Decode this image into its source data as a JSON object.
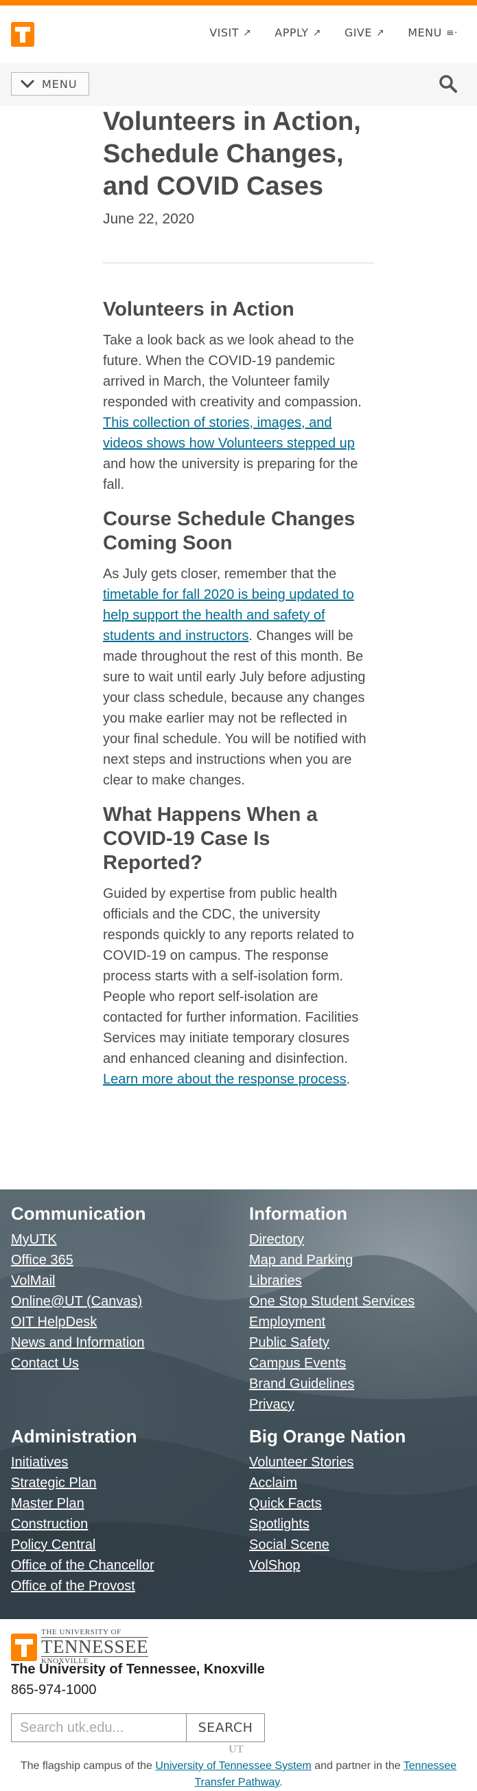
{
  "header": {
    "nav": [
      {
        "label": "VISIT",
        "suffix": "↗"
      },
      {
        "label": "APPLY",
        "suffix": "↗"
      },
      {
        "label": "GIVE",
        "suffix": "↗"
      },
      {
        "label": "MENU",
        "suffix": "≡·"
      }
    ],
    "sub_menu_label": "MENU",
    "colors": {
      "accent": "#ff8200",
      "link": "#006c93",
      "text": "#4b4b4b"
    }
  },
  "article": {
    "title": "Volunteers in Action, Schedule Changes, and COVID Cases",
    "date": "June 22, 2020",
    "s1": {
      "heading": "Volunteers in Action",
      "text_before": "Take a look back as we look ahead to the future. When the COVID-19 pandemic arrived in March, the Volunteer family responded with creativity and compassion. ",
      "link": "This collection of stories, images, and videos shows how Volunteers stepped up",
      "text_after": " and how the university is preparing for the fall."
    },
    "s2": {
      "heading": "Course Schedule Changes Coming Soon",
      "text_before": "As July gets closer, remember that the ",
      "link": "timetable for fall 2020 is being updated to help support the health and safety of students and instructors",
      "text_after": ". Changes will be made throughout the rest of this month. Be sure to wait until early July before adjusting your class schedule, because any changes you make earlier may not be reflected in your final schedule. You will be notified with next steps and instructions when you are clear to make changes."
    },
    "s3": {
      "heading": "What Happens When a COVID-19 Case Is Reported?",
      "text_before": "Guided by expertise from public health officials and the CDC, the university responds quickly to any reports related to COVID-19 on campus. The response process starts with a self-isolation form. People who report self-isolation are contacted for further information. Facilities Services may initiate temporary closures and enhanced cleaning and disinfection. ",
      "link": "Learn more about the response process",
      "text_after": "."
    }
  },
  "footer": {
    "communication": {
      "heading": "Communication",
      "links": [
        "MyUTK",
        "Office 365",
        "VolMail",
        "Online@UT (Canvas)",
        "OIT HelpDesk",
        "News and Information",
        "Contact Us"
      ]
    },
    "information": {
      "heading": "Information",
      "links": [
        "Directory",
        "Map and Parking",
        "Libraries",
        "One Stop Student Services",
        "Employment",
        "Public Safety",
        "Campus Events",
        "Brand Guidelines",
        "Privacy"
      ]
    },
    "administration": {
      "heading": "Administration",
      "links": [
        "Initiatives",
        "Strategic Plan",
        "Master Plan",
        "Construction",
        "Policy Central",
        "Office of the Chancellor",
        "Office of the Provost"
      ]
    },
    "big_orange": {
      "heading": "Big Orange Nation",
      "links": [
        "Volunteer Stories",
        "Acclaim",
        "Quick Facts",
        "Spotlights",
        "Social Scene",
        "VolShop"
      ]
    }
  },
  "bottom": {
    "logo_small_top": "THE UNIVERSITY OF",
    "logo_big": "TENNESSEE",
    "logo_small_bottom": "KNOXVILLE",
    "university_name": "The University of Tennessee, Knoxville",
    "phone": "865-974-1000",
    "search_placeholder": "Search utk.edu...",
    "search_button": "SEARCH",
    "watermark": "UT",
    "tagline_before": "The flagship campus of the ",
    "tagline_link1": "University of Tennessee System",
    "tagline_middle": " and partner in the ",
    "tagline_link2": "Tennessee Transfer Pathway",
    "tagline_after": "."
  }
}
